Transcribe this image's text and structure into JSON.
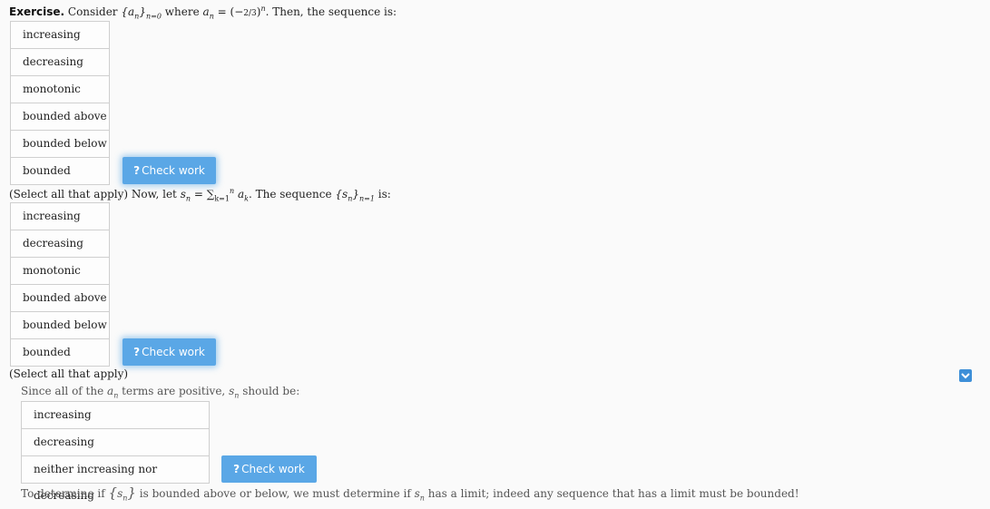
{
  "exercise": {
    "label": "Exercise.",
    "intro": "Consider",
    "seq_a": "{a",
    "seq_a_sub": "n",
    "seq_a_close": "}",
    "seq_a_range": "n=0",
    "where": "where",
    "a_n": "a",
    "a_n_sub": "n",
    "eq": "= (−",
    "frac": "2/3",
    "close_pow": ")",
    "pow": "n",
    "then": ". Then, the sequence is:"
  },
  "q1": {
    "options": [
      "increasing",
      "decreasing",
      "monotonic",
      "bounded above",
      "bounded below",
      "bounded"
    ],
    "check_label": "Check work",
    "check_icon": "?"
  },
  "q2": {
    "prefix": "(Select all that apply) Now, let",
    "s_n": "s",
    "s_n_sub": "n",
    "eq": "= ∑",
    "sum_sub": "k=1",
    "sum_sup": "n",
    "a_k": "a",
    "a_k_sub": "k",
    "mid": ". The sequence",
    "seq_s": "{s",
    "seq_s_sub": "n",
    "seq_s_close": "}",
    "seq_s_range": "n=1",
    "is": "is:",
    "options": [
      "increasing",
      "decreasing",
      "monotonic",
      "bounded above",
      "bounded below",
      "bounded"
    ],
    "check_label": "Check work",
    "check_icon": "?",
    "select_note": "(Select all that apply)"
  },
  "hint1": {
    "pre": "Since all of the",
    "a": "a",
    "a_sub": "n",
    "mid": "terms are positive,",
    "s": "s",
    "s_sub": "n",
    "post": "should be:",
    "options": [
      "increasing",
      "decreasing",
      "neither increasing nor decreasing"
    ],
    "check_label": "Check work",
    "check_icon": "?"
  },
  "hint2": {
    "pre": "To determine if",
    "brace_open": "{",
    "s": "s",
    "s_sub": "n",
    "brace_close": "}",
    "mid": "is bounded above or below, we must determine if",
    "s2": "s",
    "s2_sub": "n",
    "post": "has a limit; indeed any sequence that has a limit must be bounded!"
  },
  "icons": {
    "toggle": "chevron-down-icon"
  },
  "colors": {
    "accent": "#5aa7e6",
    "toggle": "#3d8fd8"
  }
}
